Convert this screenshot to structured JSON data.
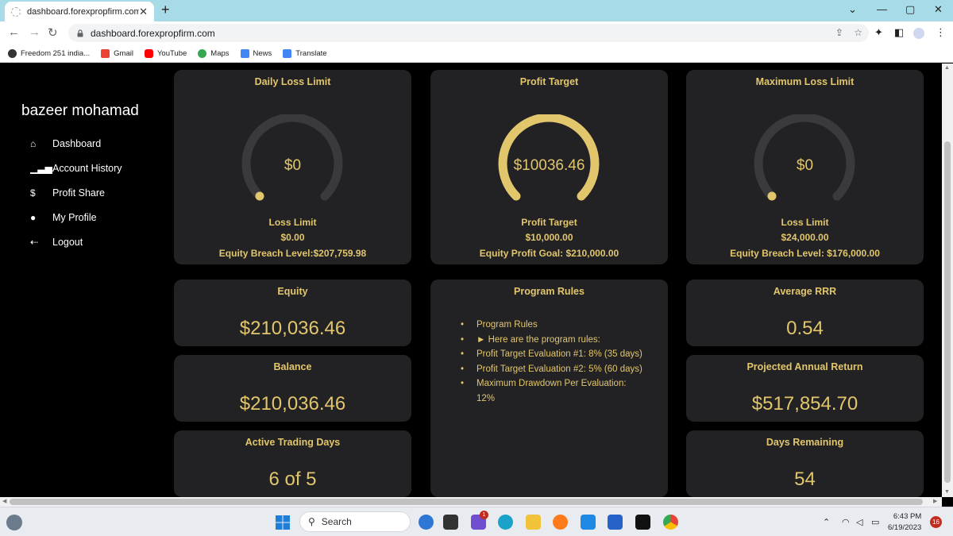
{
  "browser": {
    "tab_title": "dashboard.forexpropfirm.com",
    "url": "dashboard.forexpropfirm.com",
    "bookmarks": [
      {
        "label": "Freedom 251 india...",
        "color": "#333333"
      },
      {
        "label": "Gmail",
        "color": "#ea4335"
      },
      {
        "label": "YouTube",
        "color": "#ff0000"
      },
      {
        "label": "Maps",
        "color": "#34a853"
      },
      {
        "label": "News",
        "color": "#4285f4"
      },
      {
        "label": "Translate",
        "color": "#4285f4"
      }
    ]
  },
  "sidebar": {
    "user_name": "bazeer mohamad",
    "items": [
      {
        "label": "Dashboard",
        "icon": "home-icon"
      },
      {
        "label": "Account History",
        "icon": "bar-chart-icon"
      },
      {
        "label": "Profit Share",
        "icon": "dollar-icon"
      },
      {
        "label": "My Profile",
        "icon": "user-icon"
      },
      {
        "label": "Logout",
        "icon": "logout-icon"
      }
    ]
  },
  "theme": {
    "accent": "#e2c66c",
    "card_bg": "#222225",
    "gauge_track": "#3a3a3d",
    "page_bg": "#000000"
  },
  "gauges": [
    {
      "title": "Daily Loss Limit",
      "value": "$0",
      "fraction": 0.0,
      "line1": "Loss Limit",
      "line2": "$0.00",
      "line3": "Equity Breach Level:$207,759.98"
    },
    {
      "title": "Profit Target",
      "value": "$10036.46",
      "fraction": 1.0,
      "line1": "Profit Target",
      "line2": "$10,000.00",
      "line3": "Equity Profit Goal: $210,000.00"
    },
    {
      "title": "Maximum Loss Limit",
      "value": "$0",
      "fraction": 0.0,
      "line1": "Loss Limit",
      "line2": "$24,000.00",
      "line3": "Equity Breach Level: $176,000.00"
    }
  ],
  "stats": {
    "equity": {
      "title": "Equity",
      "value": "$210,036.46"
    },
    "balance": {
      "title": "Balance",
      "value": "$210,036.46"
    },
    "active_days": {
      "title": "Active Trading Days",
      "value": "6 of 5"
    },
    "avg_rrr": {
      "title": "Average RRR",
      "value": "0.54"
    },
    "projected": {
      "title": "Projected Annual Return",
      "value": "$517,854.70"
    },
    "days_remaining": {
      "title": "Days Remaining",
      "value": "54"
    }
  },
  "program_rules": {
    "title": "Program Rules",
    "items": [
      "Program Rules",
      "► Here are the program rules:",
      "Profit Target Evaluation #1: 8% (35 days)",
      "Profit Target Evaluation #2: 5% (60 days)",
      "Maximum Drawdown Per Evaluation: 12%"
    ]
  },
  "taskbar": {
    "search_placeholder": "Search",
    "time": "6:43 PM",
    "date": "6/19/2023",
    "notifications": "16",
    "chat_badge": "1"
  }
}
